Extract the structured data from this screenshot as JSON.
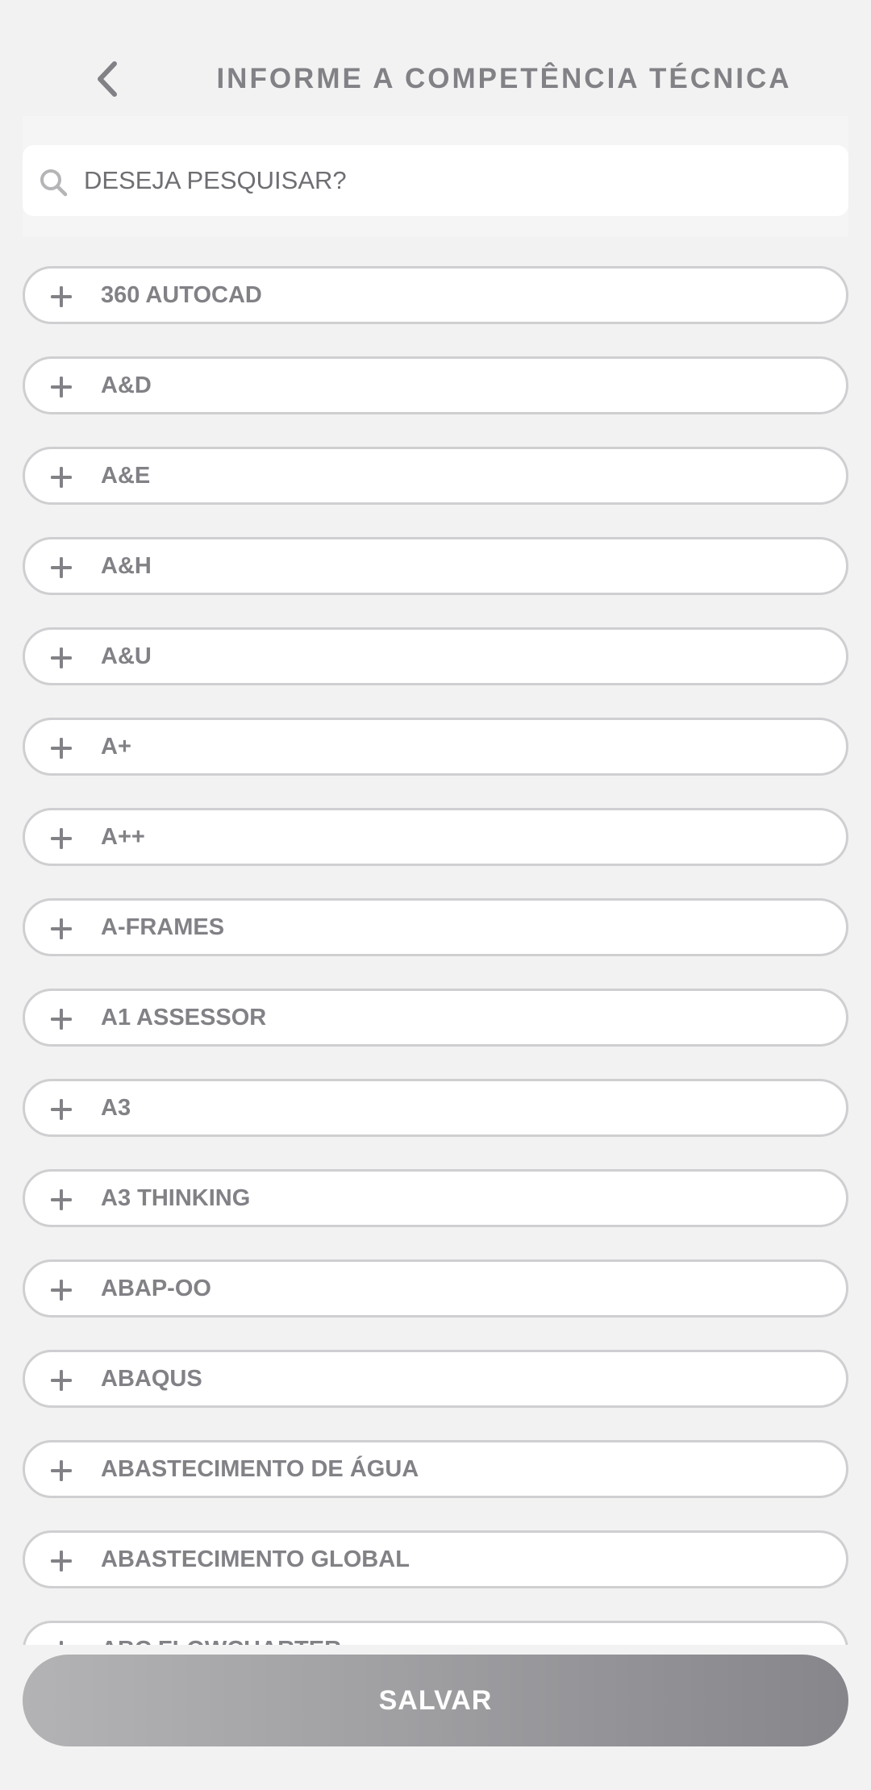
{
  "header": {
    "title": "INFORME A COMPETÊNCIA TÉCNICA",
    "back_icon": "chevron-left-icon"
  },
  "search": {
    "placeholder": "DESEJA PESQUISAR?",
    "value": "",
    "icon": "search-icon"
  },
  "list": {
    "item_icon": "plus-icon",
    "items": [
      {
        "label": "360 AUTOCAD"
      },
      {
        "label": "A&D"
      },
      {
        "label": "A&E"
      },
      {
        "label": "A&H"
      },
      {
        "label": "A&U"
      },
      {
        "label": "A+"
      },
      {
        "label": "A++"
      },
      {
        "label": "A-FRAMES"
      },
      {
        "label": "A1 ASSESSOR"
      },
      {
        "label": "A3"
      },
      {
        "label": "A3 THINKING"
      },
      {
        "label": "ABAP-OO"
      },
      {
        "label": "ABAQUS"
      },
      {
        "label": "ABASTECIMENTO DE ÁGUA"
      },
      {
        "label": "ABASTECIMENTO GLOBAL"
      },
      {
        "label": "ABC FLOWCHARTER"
      }
    ]
  },
  "footer": {
    "save_label": "SALVAR"
  },
  "colors": {
    "background": "#f2f2f2",
    "text_gray": "#818186",
    "border_gray": "#cfcfd2",
    "button_gradient_start": "#b3b3b5",
    "button_gradient_end": "#86868b"
  }
}
